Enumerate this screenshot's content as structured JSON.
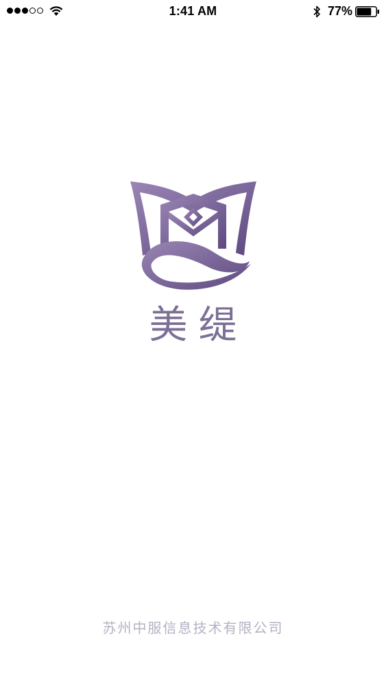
{
  "status_bar": {
    "time": "1:41 AM",
    "battery_percent": "77%",
    "signal_bars_filled": 3,
    "signal_bars_total": 5,
    "battery_level": 0.77,
    "icons": [
      "wifi-icon",
      "bluetooth-icon",
      "battery-icon"
    ]
  },
  "splash": {
    "brand_name": "美缇",
    "company_name": "苏州中服信息技术有限公司",
    "brand_color": "#7c6f96",
    "logo_gradient": [
      "#9a86b4",
      "#5e4a80"
    ],
    "company_color": "#b5b0c4"
  }
}
